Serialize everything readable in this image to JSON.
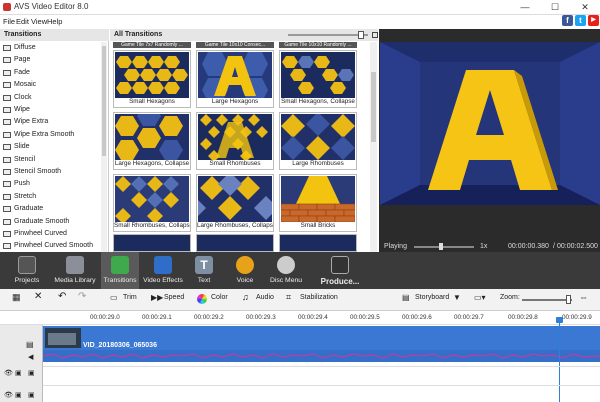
{
  "app": {
    "title": "AVS Video Editor 8.0"
  },
  "window": {
    "minimize": "—",
    "maximize": "☐",
    "close": "✕"
  },
  "menu": {
    "items": [
      "File",
      "Edit",
      "View",
      "Help"
    ]
  },
  "social": {
    "facebook": "f",
    "twitter": "t",
    "youtube": "▶"
  },
  "transitions_panel": {
    "header": "Transitions",
    "items": [
      "Diffuse",
      "Page",
      "Fade",
      "Mosaic",
      "Clock",
      "Wipe",
      "Wipe Extra",
      "Wipe Extra Smooth",
      "Slide",
      "Stencil",
      "Stencil Smooth",
      "Push",
      "Stretch",
      "Graduate",
      "Graduate Smooth",
      "Pinwheel Curved",
      "Pinwheel Curved Smooth"
    ]
  },
  "gallery": {
    "header": "All Transitions",
    "captions_top": [
      "Game Tile 7x7 Randomly ...",
      "Game Tile 10x10 Consec...",
      "Game Tile 10x10 Randomly ..."
    ],
    "thumbs": [
      "Small Hexagons",
      "Large Hexagons",
      "Small Hexagons, Collapse",
      "Large Hexagons, Collapse",
      "Small Rhombuses",
      "Large Rhombuses",
      "Small Rhombuses, Collapse",
      "Large Rhombuses, Collapse",
      "Small Bricks"
    ]
  },
  "player": {
    "status": "Playing",
    "speed": "1x",
    "current": "00:00:00.380",
    "separator": "/",
    "total": "00:00:02.500"
  },
  "toolbar": {
    "items": [
      "Projects",
      "Media Library",
      "Transitions",
      "Video Effects",
      "Text",
      "Voice",
      "Disc Menu",
      "Produce..."
    ]
  },
  "edit_tools": {
    "trim": "Trim",
    "speed": "Speed",
    "color": "Color",
    "audio": "Audio",
    "stabilization": "Stabilization",
    "storyboard": "Storyboard",
    "zoom": "Zoom:"
  },
  "ruler": {
    "ticks": [
      "00:00:29.0",
      "00:00:29.1",
      "00:00:29.2",
      "00:00:29.3",
      "00:00:29.4",
      "00:00:29.5",
      "00:00:29.6",
      "00:00:29.7",
      "00:00:29.8",
      "00:00:29.9"
    ]
  },
  "timeline": {
    "clip_name": "VID_20180306_065036"
  },
  "colors": {
    "accent": "#2f7fd6",
    "toolbar_bg": "#3a3a3a",
    "clip_blue": "#3a78d4",
    "preview_bg": "#2b2b2b"
  },
  "progress": {
    "playback_fraction": 0.15
  }
}
